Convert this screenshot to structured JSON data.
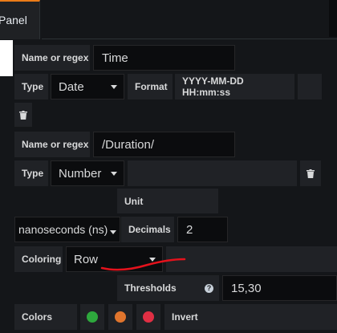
{
  "tabs": {
    "panel_label": "Panel"
  },
  "rule1": {
    "name_label": "Name or regex",
    "name_value": "Time",
    "type_label": "Type",
    "type_value": "Date",
    "format_label": "Format",
    "format_value": "YYYY-MM-DD HH:mm:ss"
  },
  "rule2": {
    "name_label": "Name or regex",
    "name_value": "/Duration/",
    "type_label": "Type",
    "type_value": "Number",
    "unit_label": "Unit",
    "unit_value": "nanoseconds (ns)",
    "decimals_label": "Decimals",
    "decimals_value": "2",
    "coloring_label": "Coloring",
    "coloring_value": "Row",
    "thresholds_label": "Thresholds",
    "thresholds_value": "15,30",
    "colors_label": "Colors",
    "invert_label": "Invert"
  },
  "colors": {
    "green": "#2ea83d",
    "orange": "#e0752d",
    "red": "#e02f44",
    "annotation": "#e4121c",
    "accent": "#eb7b18"
  },
  "icons": {
    "trash": "trash-icon",
    "help": "help-circle-icon"
  }
}
